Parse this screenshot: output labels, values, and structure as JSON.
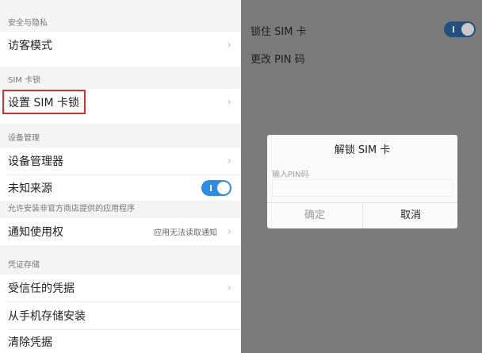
{
  "left": {
    "privacy_section": "安全与隐私",
    "guest_mode": "访客模式",
    "sim_section": "SIM 卡锁",
    "set_sim_lock": "设置 SIM 卡锁",
    "device_mgmt_section": "设备管理",
    "device_manager": "设备管理器",
    "unknown_sources": "未知来源",
    "unknown_sources_desc": "允许安装非官方商店提供的应用程序",
    "notification_access": "通知使用权",
    "notification_access_value": "应用无法读取通知",
    "credential_section": "凭证存储",
    "trusted_credentials": "受信任的凭据",
    "install_from_storage": "从手机存储安装",
    "clear_credentials": "清除凭据",
    "chevron": "›",
    "unknown_sources_enabled": true
  },
  "right": {
    "lock_sim": "锁住 SIM 卡",
    "change_pin": "更改 PIN 码",
    "lock_sim_enabled": true,
    "dialog": {
      "title": "解锁 SIM 卡",
      "input_label": "输入PIN码",
      "input_value": "",
      "ok": "确定",
      "cancel": "取消"
    }
  },
  "colors": {
    "highlight_border": "#d9302e",
    "toggle_on": "#2d8ce4",
    "dim_overlay": "#7b7b7b"
  }
}
